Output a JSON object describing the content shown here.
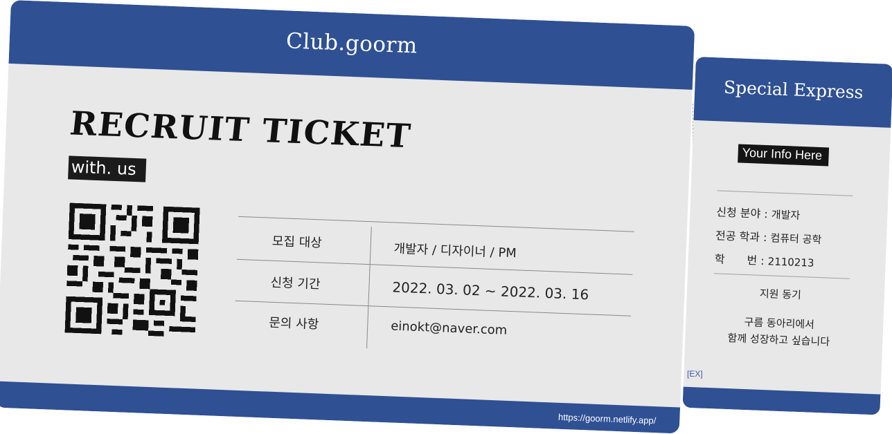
{
  "main": {
    "brand": "Club.goorm",
    "title": "RECRUIT TICKET",
    "subtitle": "with. us",
    "rows": [
      {
        "label": "모집 대상",
        "value": "개발자 / 디자이너 / PM"
      },
      {
        "label": "신청 기간",
        "value": "2022. 03. 02 ~ 2022. 03. 16"
      },
      {
        "label": "문의 사항",
        "value": "einokt@naver.com"
      }
    ],
    "url": "https://goorm.netlify.app/"
  },
  "stub": {
    "title": "Special Express",
    "info_tag": "Your Info Here",
    "field_label": "신청 분야 : ",
    "field_value": "개발자",
    "major_label": "전공 학과 : ",
    "major_value": "컴퓨터 공학",
    "id_label": "학　　번 : ",
    "id_value": "2110213",
    "motive_label": "지원 동기",
    "motive_line1": "구름 동아리에서",
    "motive_line2": "함께 성장하고 싶습니다",
    "ex": "[EX]"
  },
  "colors": {
    "band": "#2f5093",
    "paper": "#e9e8e8",
    "ink": "#151515"
  },
  "icons": [
    "qr-code-icon"
  ]
}
